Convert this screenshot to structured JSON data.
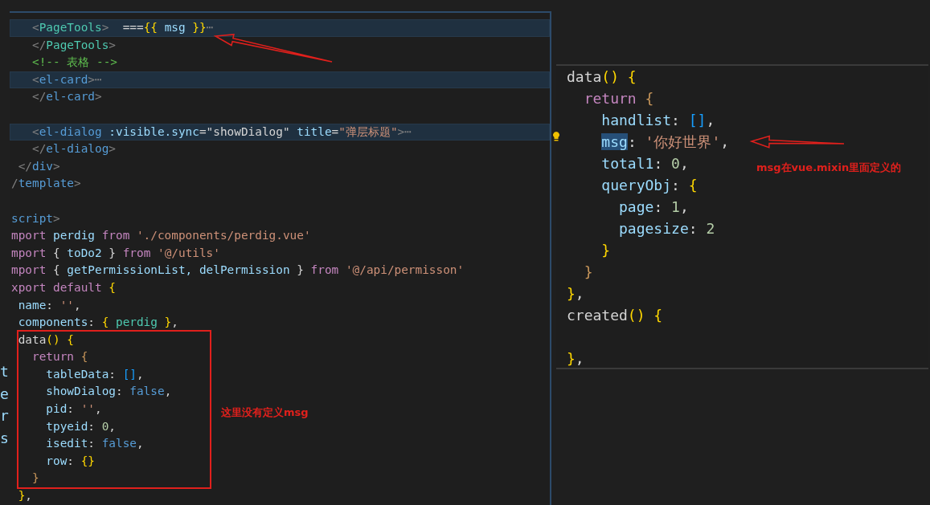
{
  "background_fragments": [
    "t",
    "e",
    "r",
    "s"
  ],
  "left_editor": {
    "lines": [
      {
        "kind": "code",
        "highlighted": true,
        "tokens": [
          {
            "t": "   <",
            "kind": "punct"
          },
          {
            "t": "PageTools",
            "kind": "component"
          },
          {
            "t": ">",
            "kind": "punct"
          },
          {
            "t": "  ===",
            "kind": "plain"
          },
          {
            "t": "{{",
            "kind": "brace"
          },
          {
            "t": " msg ",
            "kind": "var"
          },
          {
            "t": "}}",
            "kind": "brace"
          },
          {
            "t": "⋯",
            "kind": "punct"
          }
        ]
      },
      {
        "kind": "code",
        "highlighted": false,
        "tokens": [
          {
            "t": "   </",
            "kind": "punct"
          },
          {
            "t": "PageTools",
            "kind": "component"
          },
          {
            "t": ">",
            "kind": "punct"
          }
        ]
      },
      {
        "kind": "code",
        "highlighted": false,
        "tokens": [
          {
            "t": "   <!-- 表格 -->",
            "kind": "comment"
          }
        ]
      },
      {
        "kind": "code",
        "highlighted": true,
        "tokens": [
          {
            "t": "   <",
            "kind": "punct"
          },
          {
            "t": "el-card",
            "kind": "tag"
          },
          {
            "t": ">⋯",
            "kind": "punct"
          }
        ]
      },
      {
        "kind": "code",
        "highlighted": false,
        "tokens": [
          {
            "t": "   </",
            "kind": "punct"
          },
          {
            "t": "el-card",
            "kind": "tag"
          },
          {
            "t": ">",
            "kind": "punct"
          }
        ]
      },
      {
        "kind": "blank",
        "highlighted": false
      },
      {
        "kind": "code",
        "highlighted": true,
        "tokens": [
          {
            "t": "   <",
            "kind": "punct"
          },
          {
            "t": "el-dialog",
            "kind": "tag"
          },
          {
            "t": " :visible.sync",
            "kind": "attr"
          },
          {
            "t": "=\"showDialog\"",
            "kind": "plain"
          },
          {
            "t": " title",
            "kind": "attr"
          },
          {
            "t": "=",
            "kind": "plain"
          },
          {
            "t": "\"弹层标题\"",
            "kind": "string"
          },
          {
            "t": ">⋯",
            "kind": "punct"
          }
        ]
      },
      {
        "kind": "code",
        "highlighted": false,
        "tokens": [
          {
            "t": "   </",
            "kind": "punct"
          },
          {
            "t": "el-dialog",
            "kind": "tag"
          },
          {
            "t": ">",
            "kind": "punct"
          }
        ]
      },
      {
        "kind": "code",
        "highlighted": false,
        "tokens": [
          {
            "t": " </",
            "kind": "punct"
          },
          {
            "t": "div",
            "kind": "tag"
          },
          {
            "t": ">",
            "kind": "punct"
          }
        ]
      },
      {
        "kind": "code",
        "highlighted": false,
        "tokens": [
          {
            "t": "/",
            "kind": "punct"
          },
          {
            "t": "template",
            "kind": "tag"
          },
          {
            "t": ">",
            "kind": "punct"
          }
        ]
      },
      {
        "kind": "blank",
        "highlighted": false
      },
      {
        "kind": "code",
        "highlighted": false,
        "tokens": [
          {
            "t": "script",
            "kind": "tag"
          },
          {
            "t": ">",
            "kind": "punct"
          }
        ]
      },
      {
        "kind": "code",
        "highlighted": false,
        "tokens": [
          {
            "t": "mport",
            "kind": "keyword"
          },
          {
            "t": " perdig ",
            "kind": "var"
          },
          {
            "t": "from",
            "kind": "keyword"
          },
          {
            "t": " './components/perdig.vue'",
            "kind": "string"
          }
        ]
      },
      {
        "kind": "code",
        "highlighted": false,
        "tokens": [
          {
            "t": "mport",
            "kind": "keyword"
          },
          {
            "t": " { ",
            "kind": "plain"
          },
          {
            "t": "toDo2",
            "kind": "var"
          },
          {
            "t": " } ",
            "kind": "plain"
          },
          {
            "t": "from",
            "kind": "keyword"
          },
          {
            "t": " '@/utils'",
            "kind": "string"
          }
        ]
      },
      {
        "kind": "code",
        "highlighted": false,
        "tokens": [
          {
            "t": "mport",
            "kind": "keyword"
          },
          {
            "t": " { ",
            "kind": "plain"
          },
          {
            "t": "getPermissionList, delPermission",
            "kind": "var"
          },
          {
            "t": " } ",
            "kind": "plain"
          },
          {
            "t": "from",
            "kind": "keyword"
          },
          {
            "t": " '@/api/permisson'",
            "kind": "string"
          }
        ]
      },
      {
        "kind": "code",
        "highlighted": false,
        "tokens": [
          {
            "t": "xport",
            "kind": "keyword"
          },
          {
            "t": " default ",
            "kind": "keyword"
          },
          {
            "t": "{",
            "kind": "brace"
          }
        ]
      },
      {
        "kind": "code",
        "highlighted": false,
        "tokens": [
          {
            "t": " name",
            "kind": "var"
          },
          {
            "t": ": ",
            "kind": "plain"
          },
          {
            "t": "''",
            "kind": "string"
          },
          {
            "t": ",",
            "kind": "plain"
          }
        ]
      },
      {
        "kind": "code",
        "highlighted": false,
        "tokens": [
          {
            "t": " components",
            "kind": "var"
          },
          {
            "t": ": ",
            "kind": "plain"
          },
          {
            "t": "{ ",
            "kind": "brace"
          },
          {
            "t": "perdig",
            "kind": "component"
          },
          {
            "t": " }",
            "kind": "brace"
          },
          {
            "t": ",",
            "kind": "plain"
          }
        ]
      },
      {
        "kind": "code",
        "highlighted": false,
        "tokens": [
          {
            "t": " data",
            "kind": "plain"
          },
          {
            "t": "() {",
            "kind": "brace"
          }
        ]
      },
      {
        "kind": "code",
        "highlighted": false,
        "tokens": [
          {
            "t": "   return",
            "kind": "keyword"
          },
          {
            "t": " {",
            "kind": "brace2"
          }
        ]
      },
      {
        "kind": "code",
        "highlighted": false,
        "tokens": [
          {
            "t": "     tableData",
            "kind": "var"
          },
          {
            "t": ": ",
            "kind": "plain"
          },
          {
            "t": "[]",
            "kind": "brace3"
          },
          {
            "t": ",",
            "kind": "plain"
          }
        ]
      },
      {
        "kind": "code",
        "highlighted": false,
        "tokens": [
          {
            "t": "     showDialog",
            "kind": "var"
          },
          {
            "t": ": ",
            "kind": "plain"
          },
          {
            "t": "false",
            "kind": "bool"
          },
          {
            "t": ",",
            "kind": "plain"
          }
        ]
      },
      {
        "kind": "code",
        "highlighted": false,
        "tokens": [
          {
            "t": "     pid",
            "kind": "var"
          },
          {
            "t": ": ",
            "kind": "plain"
          },
          {
            "t": "''",
            "kind": "string"
          },
          {
            "t": ",",
            "kind": "plain"
          }
        ]
      },
      {
        "kind": "code",
        "highlighted": false,
        "tokens": [
          {
            "t": "     tpyeid",
            "kind": "var"
          },
          {
            "t": ": ",
            "kind": "plain"
          },
          {
            "t": "0",
            "kind": "num"
          },
          {
            "t": ",",
            "kind": "plain"
          }
        ]
      },
      {
        "kind": "code",
        "highlighted": false,
        "tokens": [
          {
            "t": "     isedit",
            "kind": "var"
          },
          {
            "t": ": ",
            "kind": "plain"
          },
          {
            "t": "false",
            "kind": "bool"
          },
          {
            "t": ",",
            "kind": "plain"
          }
        ]
      },
      {
        "kind": "code",
        "highlighted": false,
        "tokens": [
          {
            "t": "     row",
            "kind": "var"
          },
          {
            "t": ": ",
            "kind": "plain"
          },
          {
            "t": "{}",
            "kind": "brace"
          }
        ]
      },
      {
        "kind": "code",
        "highlighted": false,
        "tokens": [
          {
            "t": "   }",
            "kind": "brace2"
          }
        ]
      },
      {
        "kind": "code",
        "highlighted": false,
        "tokens": [
          {
            "t": " }",
            "kind": "brace"
          },
          {
            "t": ",",
            "kind": "plain"
          }
        ]
      }
    ]
  },
  "right_editor": {
    "lines": [
      {
        "kind": "code",
        "tokens": [
          {
            "t": "data",
            "kind": "plain"
          },
          {
            "t": "() {",
            "kind": "brace"
          }
        ]
      },
      {
        "kind": "code",
        "tokens": [
          {
            "t": "  return",
            "kind": "keyword"
          },
          {
            "t": " {",
            "kind": "brace2"
          }
        ]
      },
      {
        "kind": "code",
        "tokens": [
          {
            "t": "    handlist",
            "kind": "var"
          },
          {
            "t": ": ",
            "kind": "plain"
          },
          {
            "t": "[]",
            "kind": "brace3"
          },
          {
            "t": ",",
            "kind": "plain"
          }
        ]
      },
      {
        "kind": "code",
        "tokens": [
          {
            "t": "    msg",
            "kind": "match"
          },
          {
            "t": ": ",
            "kind": "plain"
          },
          {
            "t": "'你好世界'",
            "kind": "string"
          },
          {
            "t": ",",
            "kind": "plain"
          }
        ]
      },
      {
        "kind": "code",
        "tokens": [
          {
            "t": "    total1",
            "kind": "var"
          },
          {
            "t": ": ",
            "kind": "plain"
          },
          {
            "t": "0",
            "kind": "num"
          },
          {
            "t": ",",
            "kind": "plain"
          }
        ]
      },
      {
        "kind": "code",
        "tokens": [
          {
            "t": "    queryObj",
            "kind": "var"
          },
          {
            "t": ": ",
            "kind": "plain"
          },
          {
            "t": "{",
            "kind": "brace"
          }
        ]
      },
      {
        "kind": "code",
        "tokens": [
          {
            "t": "      page",
            "kind": "var"
          },
          {
            "t": ": ",
            "kind": "plain"
          },
          {
            "t": "1",
            "kind": "num"
          },
          {
            "t": ",",
            "kind": "plain"
          }
        ]
      },
      {
        "kind": "code",
        "tokens": [
          {
            "t": "      pagesize",
            "kind": "var"
          },
          {
            "t": ": ",
            "kind": "plain"
          },
          {
            "t": "2",
            "kind": "num"
          }
        ]
      },
      {
        "kind": "code",
        "tokens": [
          {
            "t": "    }",
            "kind": "brace"
          }
        ]
      },
      {
        "kind": "code",
        "tokens": [
          {
            "t": "  }",
            "kind": "brace2"
          }
        ]
      },
      {
        "kind": "code",
        "tokens": [
          {
            "t": "}",
            "kind": "brace"
          },
          {
            "t": ",",
            "kind": "plain"
          }
        ]
      },
      {
        "kind": "code",
        "tokens": [
          {
            "t": "created",
            "kind": "plain"
          },
          {
            "t": "() {",
            "kind": "brace"
          }
        ]
      },
      {
        "kind": "blank"
      },
      {
        "kind": "code",
        "tokens": [
          {
            "t": "}",
            "kind": "brace"
          },
          {
            "t": ",",
            "kind": "plain"
          }
        ]
      }
    ]
  },
  "annotations": [
    {
      "text": "这里没有定义msg"
    },
    {
      "text": "msg在vue.mixin里面定义的"
    }
  ]
}
